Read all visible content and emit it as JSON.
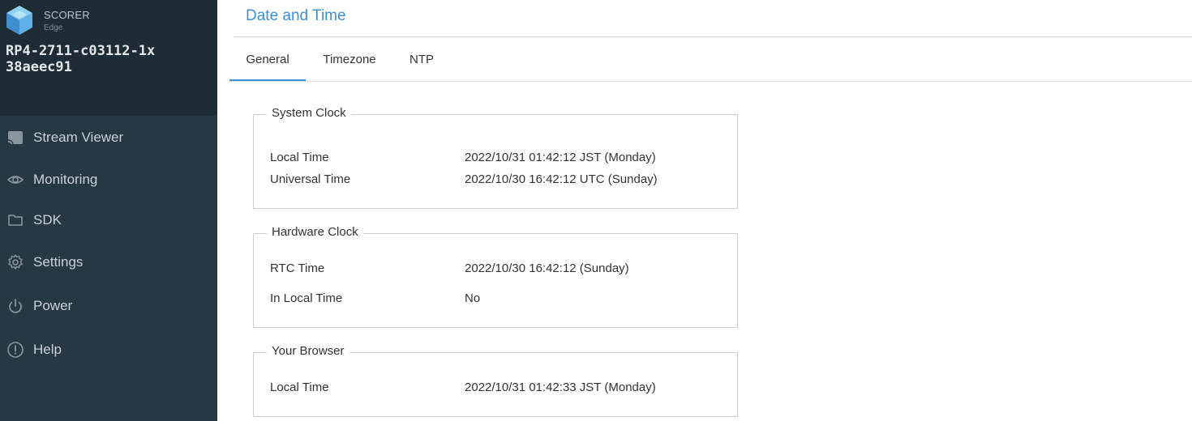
{
  "brand": {
    "name": "SCORER",
    "sub": "Edge",
    "device_line1": "RP4-2711-c03112-1x",
    "device_line2": "38aeec91",
    "logo_icon": "cube-logo-icon"
  },
  "sidebar": {
    "items": [
      {
        "label": "Stream Viewer",
        "icon": "cast-icon"
      },
      {
        "label": "Monitoring",
        "icon": "eye-icon"
      },
      {
        "label": "SDK",
        "icon": "folder-icon"
      },
      {
        "label": "Settings",
        "icon": "gear-icon"
      },
      {
        "label": "Power",
        "icon": "power-icon"
      },
      {
        "label": "Help",
        "icon": "exclamation-circle-icon"
      }
    ]
  },
  "page": {
    "title": "Date and Time"
  },
  "tabs": [
    {
      "label": "General",
      "active": true
    },
    {
      "label": "Timezone",
      "active": false
    },
    {
      "label": "NTP",
      "active": false
    }
  ],
  "sections": {
    "system_clock": {
      "title": "System Clock",
      "rows": [
        {
          "label": "Local Time",
          "value": "2022/10/31 01:42:12 JST (Monday)"
        },
        {
          "label": "Universal Time",
          "value": "2022/10/30 16:42:12 UTC (Sunday)"
        }
      ]
    },
    "hardware_clock": {
      "title": "Hardware Clock",
      "rows": [
        {
          "label": "RTC Time",
          "value": "2022/10/30 16:42:12 (Sunday)"
        },
        {
          "label": "In Local Time",
          "value": "No"
        }
      ]
    },
    "your_browser": {
      "title": "Your Browser",
      "rows": [
        {
          "label": "Local Time",
          "value": "2022/10/31 01:42:33 JST (Monday)"
        }
      ]
    }
  },
  "colors": {
    "accent": "#3d8fd6",
    "sidebar_bg": "#263843",
    "brand_bg": "#1e2c35"
  }
}
